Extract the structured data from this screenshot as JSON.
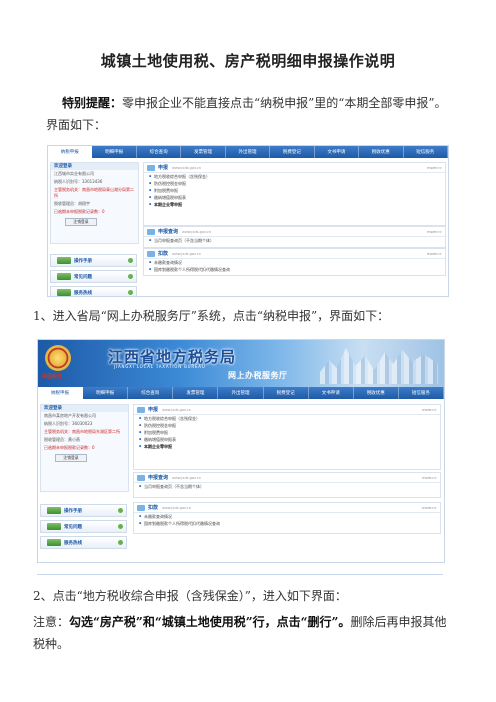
{
  "title": "城镇土地使用税、房产税明细申报操作说明",
  "notice": {
    "label": "特别提醒：",
    "text": "零申报企业不能直接点击“纳税申报”里的“本期全部零申报”。界面如下："
  },
  "step1": "1、进入省局“网上办税服务厅”系统，点击“纳税申报”，界面如下：",
  "step2": "2、点击“地方税收综合申报（含残保金）”，进入如下界面：",
  "note": {
    "label": "注意：",
    "bold": "勾选“房产税”和“城镇土地使用税”行，点击“删行”。",
    "rest": "删除后再申报其他税种。"
  },
  "banner": {
    "title": "江西省地方税务局",
    "subtitle": "JIANGXI LOCAL TAXATION BUREAU",
    "hall": "网上办税服务厅",
    "emblem_text": "中国税务"
  },
  "nav_tabs": [
    "纳税申报",
    "明细申报",
    "综合查询",
    "发票管理",
    "外出管理",
    "税费登记",
    "文书申请",
    "税收优惠",
    "短信服务"
  ],
  "screen1": {
    "side": {
      "header": "欢迎登录",
      "company": "江西城市实业有限公司",
      "id_line": "纳税人识别号：33013436",
      "tax_office": "主管税务机关：南昌市地税局青山湖分局第二所",
      "admin": "税收管理员：胡翔宇",
      "warning": "已逾期未申报税款记录数：0",
      "button": "注销登录"
    },
    "side_buttons": [
      "操作手册",
      "常见问题",
      "服务热线"
    ],
    "panel_declare": {
      "title": "申报",
      "sub": "www.jxds.gov.cn",
      "more": "more>>",
      "items": [
        "地方税收综合申报（含残保金）",
        "防伪税控税金申报",
        "附加税费申报",
        "缴纳增值税申报表",
        "本期企业零申报"
      ]
    },
    "panel_check": {
      "title": "申报查询",
      "sub": "www.jxds.gov.cn",
      "more": "more>>",
      "items": [
        "当月申报查询页（不含当期个体）"
      ]
    },
    "panel_pay": {
      "title": "扣款",
      "sub": "www.jxds.gov.cn",
      "more": "more>>",
      "items": [
        "未缴款查询情况",
        "国库划缴税款个人所得税代扣代缴情况查询"
      ]
    }
  },
  "screen2": {
    "side": {
      "header": "欢迎登录",
      "company": "南昌市某房地产开发有限公司",
      "id_line": "纳税人识别号：36030023",
      "tax_office": "主管税务机关：南昌市地税局东湖区第二所",
      "admin": "税收管理员：黄小燕",
      "warning": "已逾期未申报税款记录数：0",
      "button": "注销登录"
    },
    "side_buttons": [
      "操作手册",
      "常见问题",
      "服务热线"
    ],
    "panel_declare": {
      "title": "申报",
      "sub": "www.jxds.gov.cn",
      "more": "more>>",
      "items": [
        "地方税收综合申报（含残保金）",
        "防伪税控税金申报",
        "附加税费申报",
        "缴纳增值税申报表",
        "本期企业零申报"
      ]
    },
    "panel_check": {
      "title": "申报查询",
      "sub": "www.jxds.gov.cn",
      "more": "more>>",
      "items": [
        "当月申报查询页（不含当期个体）"
      ]
    },
    "panel_pay": {
      "title": "扣款",
      "sub": "www.jxds.gov.cn",
      "more": "more>>",
      "items": [
        "未缴款查询情况",
        "国库划缴税款个人所得税代扣代缴情况查询"
      ]
    }
  }
}
